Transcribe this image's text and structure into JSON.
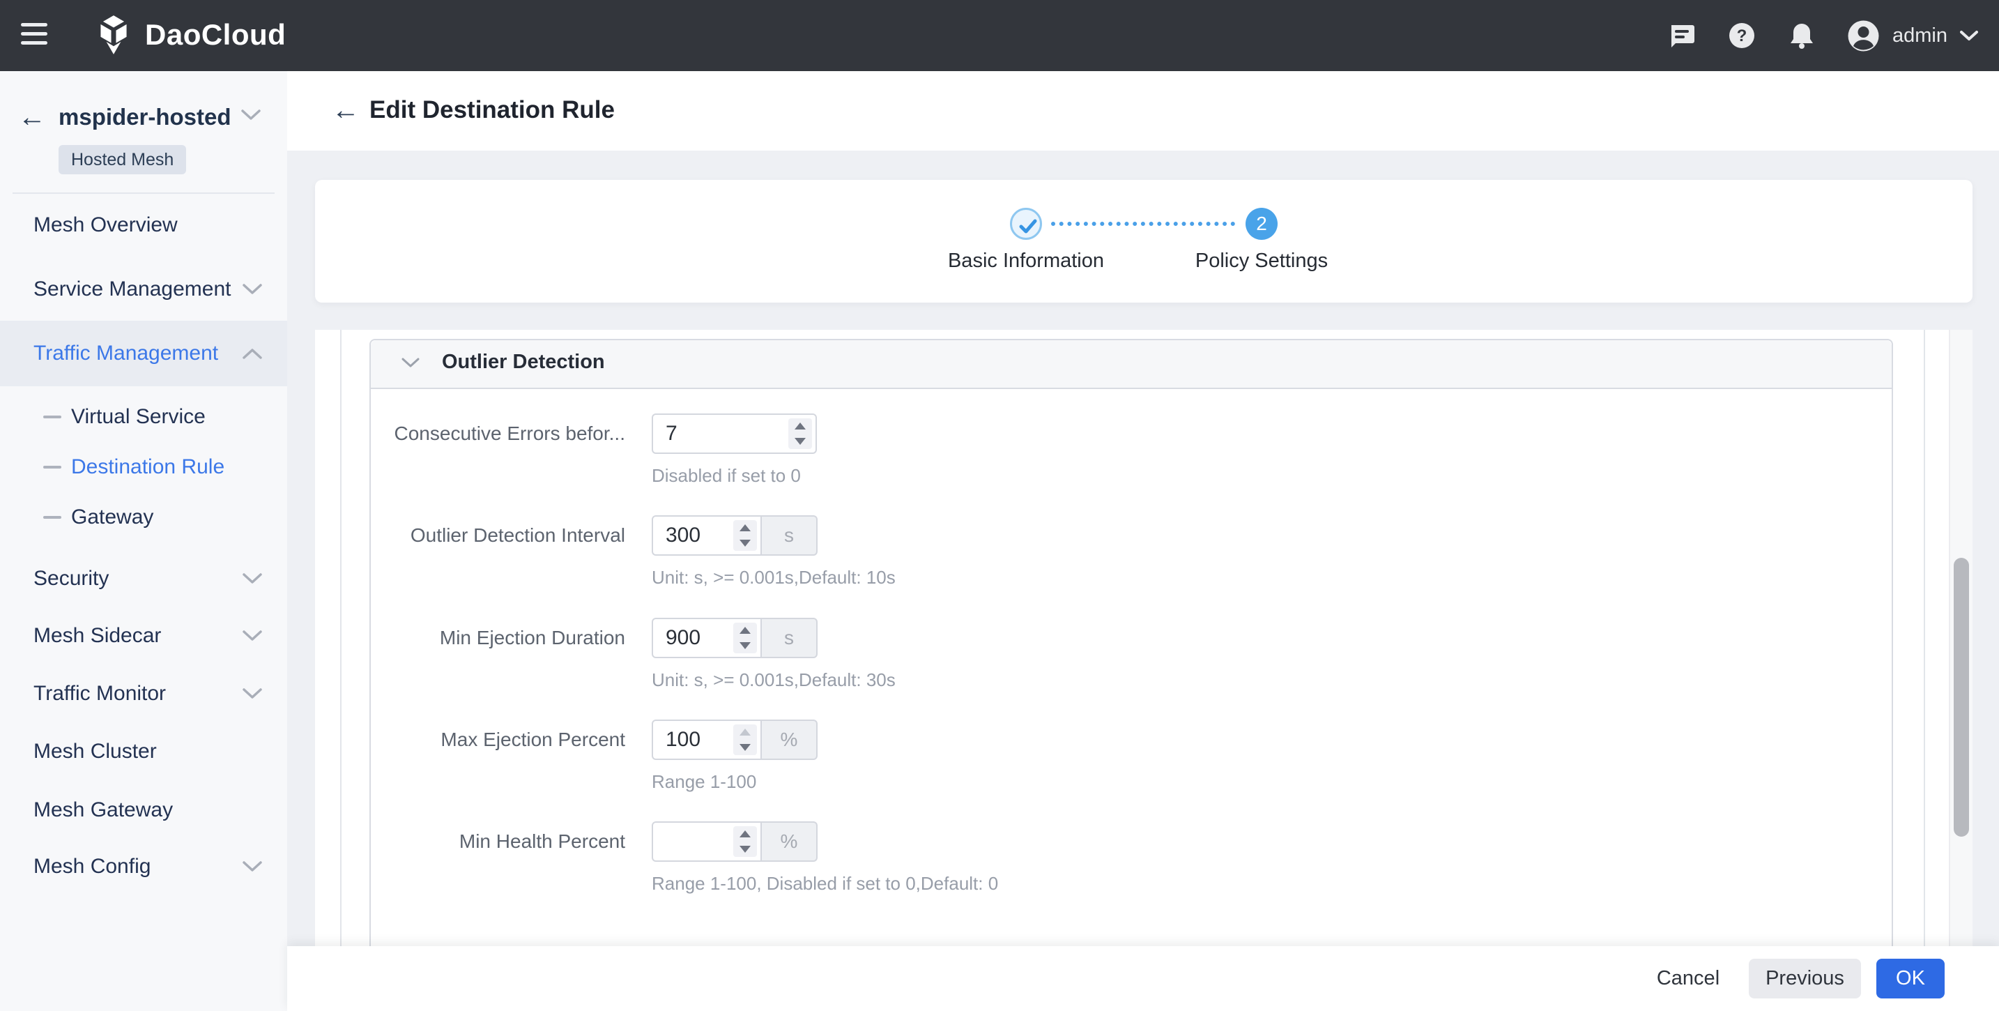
{
  "topbar": {
    "brand": "DaoCloud",
    "user": "admin"
  },
  "sidebar": {
    "workspace": "mspider-hosted",
    "badge": "Hosted Mesh",
    "items": [
      {
        "label": "Mesh Overview"
      },
      {
        "label": "Service Management"
      },
      {
        "label": "Traffic Management"
      },
      {
        "label": "Virtual Service"
      },
      {
        "label": "Destination Rule"
      },
      {
        "label": "Gateway"
      },
      {
        "label": "Security"
      },
      {
        "label": "Mesh Sidecar"
      },
      {
        "label": "Traffic Monitor"
      },
      {
        "label": "Mesh Cluster"
      },
      {
        "label": "Mesh Gateway"
      },
      {
        "label": "Mesh Config"
      }
    ]
  },
  "page": {
    "title": "Edit Destination Rule"
  },
  "stepper": {
    "step1_label": "Basic Information",
    "step2_label": "Policy Settings",
    "step2_number": "2"
  },
  "section": {
    "title": "Outlier Detection"
  },
  "form": {
    "rows": [
      {
        "label": "Consecutive Errors befor...",
        "value": "7",
        "addon": "",
        "helper": "Disabled if set to 0"
      },
      {
        "label": "Outlier Detection Interval",
        "value": "300",
        "addon": "s",
        "helper": "Unit: s, >= 0.001s,Default: 10s"
      },
      {
        "label": "Min Ejection Duration",
        "value": "900",
        "addon": "s",
        "helper": "Unit: s, >= 0.001s,Default: 30s"
      },
      {
        "label": "Max Ejection Percent",
        "value": "100",
        "addon": "%",
        "helper": "Range 1-100"
      },
      {
        "label": "Min Health Percent",
        "value": "",
        "addon": "%",
        "helper": "Range 1-100, Disabled if set to 0,Default: 0"
      }
    ]
  },
  "footer": {
    "cancel": "Cancel",
    "previous": "Previous",
    "ok": "OK"
  },
  "colors": {
    "topbar_bg": "#33363c",
    "sidebar_bg": "#f7f8fa",
    "active_blue": "#3c78e8",
    "stepper_blue": "#49a3e9",
    "ok_blue": "#2e6ae4",
    "page_bg": "#eef0f4"
  }
}
